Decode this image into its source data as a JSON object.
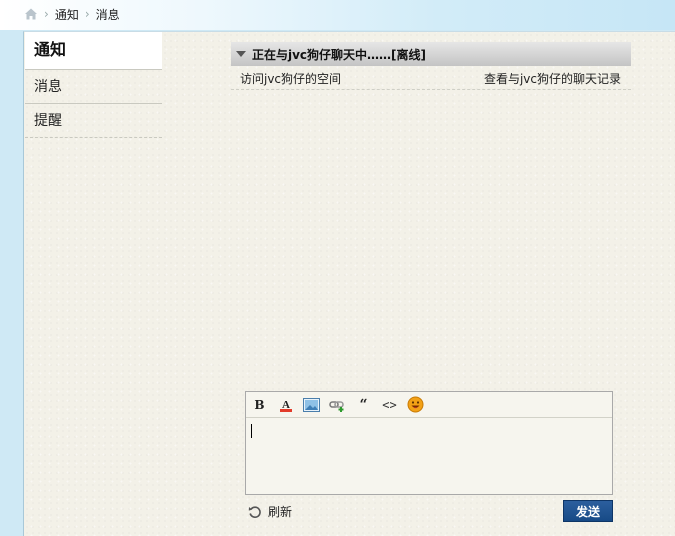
{
  "breadcrumb": {
    "home_icon": "home-icon",
    "items": [
      "通知",
      "消息"
    ]
  },
  "sidebar": {
    "title": "通知",
    "items": [
      {
        "label": "消息"
      },
      {
        "label": "提醒"
      }
    ]
  },
  "chat": {
    "header_title": "正在与jvc狗仔聊天中……[离线]",
    "visit_link": "访问jvc狗仔的空间",
    "history_link": "查看与jvc狗仔的聊天记录"
  },
  "editor": {
    "toolbar": [
      {
        "name": "bold-button",
        "icon": "bold-icon",
        "glyph": "B"
      },
      {
        "name": "font-color-button",
        "icon": "font-color-icon",
        "glyph": "A"
      },
      {
        "name": "image-button",
        "icon": "image-icon"
      },
      {
        "name": "link-button",
        "icon": "link-icon"
      },
      {
        "name": "quote-button",
        "icon": "quote-icon",
        "glyph": "“"
      },
      {
        "name": "code-button",
        "icon": "code-icon",
        "glyph": "<>"
      },
      {
        "name": "emoji-button",
        "icon": "smiley-icon"
      }
    ],
    "value": ""
  },
  "actions": {
    "refresh_label": "刷新",
    "send_label": "发送"
  },
  "colors": {
    "send_button": "#1f538f",
    "panel_background": "#f3f1e8",
    "header_gradient_top": "#e6e6e6",
    "header_gradient_bottom": "#c4c4c4"
  }
}
